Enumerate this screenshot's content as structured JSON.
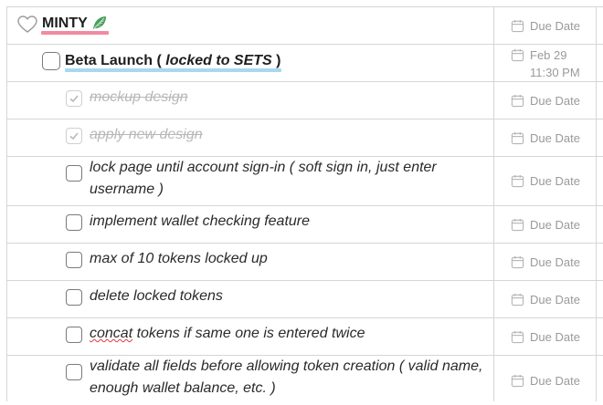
{
  "project": {
    "title": "MINTY",
    "date_label": "Due Date"
  },
  "milestone": {
    "title": "Beta Launch (",
    "title_italic": "locked to SETS",
    "title_close": ")",
    "date_line1": "Feb 29",
    "date_line2": "11:30 PM"
  },
  "tasks": [
    {
      "text_a": "mockup",
      "text_b": " design",
      "done": true,
      "due": "Due Date"
    },
    {
      "text": "apply new design",
      "done": true,
      "due": "Due Date"
    },
    {
      "text_line1": "lock page until account sign-in ( soft sign in, just enter",
      "text_line2": "username )",
      "done": false,
      "due": "Due Date"
    },
    {
      "text": "implement wallet checking feature",
      "done": false,
      "due": "Due Date"
    },
    {
      "text": "max of 10 tokens locked up",
      "done": false,
      "due": "Due Date"
    },
    {
      "text": "delete locked tokens",
      "done": false,
      "due": "Due Date"
    },
    {
      "text_a": "concat",
      "text_b": " tokens if same one is entered twice",
      "done": false,
      "due": "Due Date"
    },
    {
      "text_line1": "validate all fields before allowing token creation ( valid name,",
      "text_line2": "enough wallet balance, etc. )",
      "done": false,
      "due": "Due Date"
    }
  ],
  "colors": {
    "pink_underline": "#f28aa0",
    "blue_underline": "#a8d8f0",
    "leaf": "#3f9b5a"
  },
  "icons": [
    "heart-icon",
    "leaf-icon",
    "calendar-icon",
    "checkmark-icon"
  ]
}
